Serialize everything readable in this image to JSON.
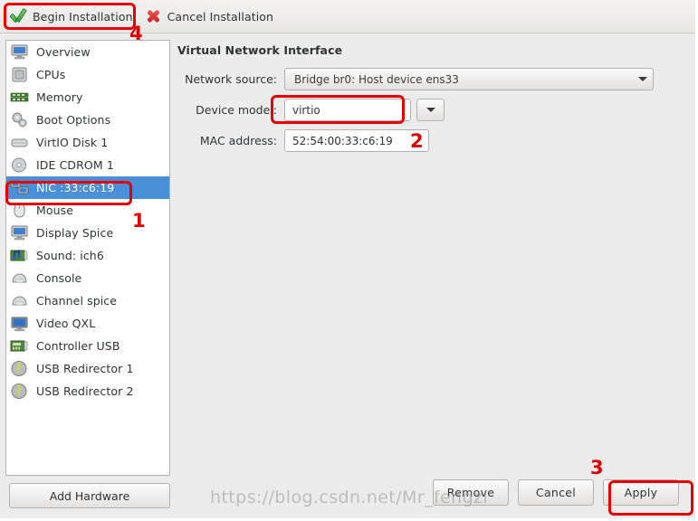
{
  "toolbar": {
    "begin_label": "Begin Installation",
    "begin_icon": "green-check-icon",
    "cancel_label": "Cancel Installation",
    "cancel_icon": "red-x-icon"
  },
  "sidebar": {
    "add_hardware_label": "Add Hardware",
    "items": [
      {
        "label": "Overview",
        "icon": "monitor-icon",
        "selected": false
      },
      {
        "label": "CPUs",
        "icon": "cpu-chip-icon",
        "selected": false
      },
      {
        "label": "Memory",
        "icon": "memory-icon",
        "selected": false
      },
      {
        "label": "Boot Options",
        "icon": "gears-icon",
        "selected": false
      },
      {
        "label": "VirtIO Disk 1",
        "icon": "harddisk-icon",
        "selected": false
      },
      {
        "label": "IDE CDROM 1",
        "icon": "cdrom-icon",
        "selected": false
      },
      {
        "label": "NIC :33:c6:19",
        "icon": "network-icon",
        "selected": true
      },
      {
        "label": "Mouse",
        "icon": "mouse-icon",
        "selected": false
      },
      {
        "label": "Display Spice",
        "icon": "monitor-icon",
        "selected": false
      },
      {
        "label": "Sound: ich6",
        "icon": "soundcard-icon",
        "selected": false
      },
      {
        "label": "Console",
        "icon": "console-icon",
        "selected": false
      },
      {
        "label": "Channel spice",
        "icon": "console-icon",
        "selected": false
      },
      {
        "label": "Video QXL",
        "icon": "video-icon",
        "selected": false
      },
      {
        "label": "Controller USB",
        "icon": "usbcard-icon",
        "selected": false
      },
      {
        "label": "USB Redirector 1",
        "icon": "usb-icon",
        "selected": false
      },
      {
        "label": "USB Redirector 2",
        "icon": "usb-icon",
        "selected": false
      }
    ]
  },
  "panel": {
    "title": "Virtual Network Interface",
    "network_source": {
      "label": "Network source:",
      "value": "Bridge br0: Host device ens33",
      "icon": "chevron-down-icon"
    },
    "device_model": {
      "label": "Device model:",
      "value": "virtio",
      "icon": "chevron-down-icon"
    },
    "mac_address": {
      "label": "MAC address:",
      "value": "52:54:00:33:c6:19"
    }
  },
  "buttons": {
    "remove": "Remove",
    "cancel": "Cancel",
    "apply": "Apply"
  },
  "annotations": {
    "one": "1",
    "two": "2",
    "three": "3",
    "four": "4",
    "accent_color": "#e60000"
  },
  "watermark": "https://blog.csdn.net/Mr_fengzi"
}
